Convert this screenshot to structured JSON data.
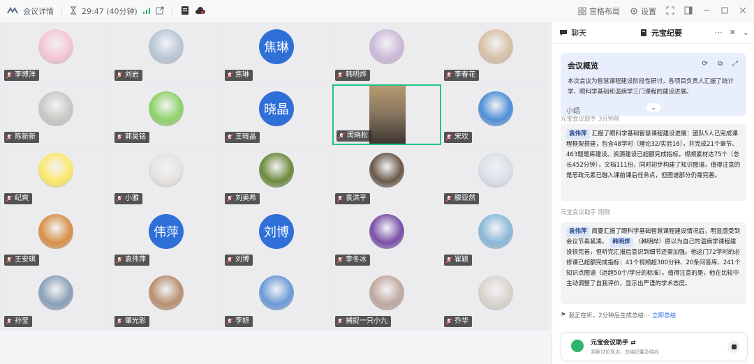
{
  "titlebar": {
    "meeting_info": "会议详情",
    "timer": "29:47 (40分钟)",
    "layout_label": "宫格布局",
    "settings_label": "设置"
  },
  "participants": [
    {
      "name": "李博洋",
      "avatar": "cartoon-pig",
      "color": "#f4c6d4"
    },
    {
      "name": "刘岩",
      "avatar": "photo-man",
      "color": "#b9c5d6"
    },
    {
      "name": "焦琳",
      "avatar_text": "焦琳",
      "color": "#2f6fd8"
    },
    {
      "name": "韩明烨",
      "avatar": "photo-vase",
      "color": "#cbb9d8"
    },
    {
      "name": "李春花",
      "avatar": "photo-office",
      "color": "#d8c0a6"
    },
    {
      "name": "陈新新",
      "avatar": "photo-hand",
      "color": "#c8c8c4"
    },
    {
      "name": "郭昊铭",
      "avatar": "cartoon-frog",
      "color": "#8ed36a"
    },
    {
      "name": "王晓晶",
      "avatar_text": "晓晶",
      "color": "#2f6fd8"
    },
    {
      "name": "闵晓松",
      "avatar": "video-feed",
      "color": "#8a7860",
      "active": true
    },
    {
      "name": "宋欢",
      "avatar": "photo-sunflower",
      "color": "#4f8ed8"
    },
    {
      "name": "纪爽",
      "avatar": "crown",
      "color": "#fbe96a"
    },
    {
      "name": "小雅",
      "avatar": "photo-woman",
      "color": "#e6e3e0"
    },
    {
      "name": "刘美希",
      "avatar": "photo-flower",
      "color": "#6c8a3c"
    },
    {
      "name": "袁洪平",
      "avatar": "photo-camera",
      "color": "#6a5848"
    },
    {
      "name": "滕亚然",
      "avatar": "photo-snow",
      "color": "#d8e0e8"
    },
    {
      "name": "王安琪",
      "avatar": "photo-cat",
      "color": "#d99048"
    },
    {
      "name": "袁伟萍",
      "avatar_text": "伟萍",
      "color": "#2f6fd8"
    },
    {
      "name": "刘博",
      "avatar_text": "刘博",
      "color": "#2f6fd8"
    },
    {
      "name": "李冬冰",
      "avatar": "photo-purple",
      "color": "#7a4fa8"
    },
    {
      "name": "崔颖",
      "avatar": "photo-landscape",
      "color": "#8bb8d8"
    },
    {
      "name": "孙莹",
      "avatar": "photo-trees",
      "color": "#8aa0b8"
    },
    {
      "name": "肇光影",
      "avatar": "photo-girl",
      "color": "#b89070"
    },
    {
      "name": "李妍",
      "avatar": "photo-cartoon",
      "color": "#6a9ad8"
    },
    {
      "name": "捕捉一只小九",
      "avatar": "photo-portrait",
      "color": "#c0a8a0"
    },
    {
      "name": "乔华",
      "avatar": "photo-sketch",
      "color": "#d8d4cc"
    }
  ],
  "panel": {
    "tab_chat": "聊天",
    "tab_notes": "元宝纪要",
    "overview_title": "会议概览",
    "overview_text": "本次会议为智慧课程建设阶段性研讨，各项目负责人汇报了统计学、眼科学基础和温病学三门课程的建设进展。",
    "summary_label": "小结",
    "msg1_head": "元宝会议助手  3分钟前",
    "msg1_mention": "袁伟萍",
    "msg1_text": "汇报了眼科学基础智慧课程建设进展：团队5人已完成课程框架搭建，包含48学时（理论32/实验16），并完成21个章节、463题题库建设。资源建设已超额完成指标，视频素材达75个（总长452分钟），文档111份，同时初步构建了知识图谱。值得注意的是思政元素已融入课前课后任务点，但图谱部分仍需完善。",
    "msg2_head": "元宝会议助手  刚刚",
    "msg2_mention1": "袁伟萍",
    "msg2_text1": "简要汇报了眼科学基础智慧课程建设情况后，明显感受到会议节奏紧凑。",
    "msg2_mention2": "韩明烨",
    "msg2_text2": "（韩明烨）原以为自己的温病学课程建设很完善，但听完汇报后意识到细节还需加强。他这门72学时的必修课已超额完成指标：41个视频超300分钟、20条问答库、241个知识点图谱（远超50个/学分的标准）。值得注意的是，他在比较中主动调整了自我评价，显示出严谨的学术态度。",
    "listening": "我正在听，2分钟后生成总结···",
    "summarize_now": "立即总结",
    "assistant_name": "元宝会议助手",
    "assistant_sub": "洞察讨论观点，总结纪要及待办"
  }
}
